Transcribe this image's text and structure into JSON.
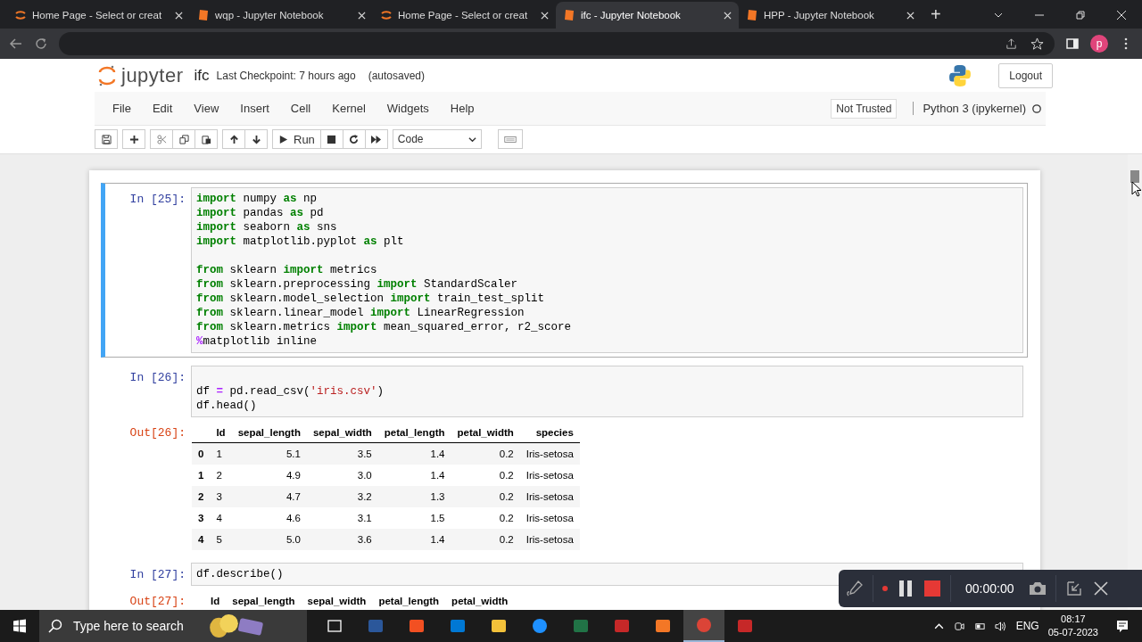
{
  "browser": {
    "tabs": [
      {
        "title": "Home Page - Select or creat",
        "kind": "home",
        "selected": false
      },
      {
        "title": "wqp - Jupyter Notebook",
        "kind": "notebook",
        "selected": false
      },
      {
        "title": "Home Page - Select or creat",
        "kind": "home",
        "selected": false
      },
      {
        "title": "ifc - Jupyter Notebook",
        "kind": "notebook",
        "selected": true
      },
      {
        "title": "HPP - Jupyter Notebook",
        "kind": "notebook",
        "selected": false
      }
    ],
    "new_tab": "+",
    "profile": "p"
  },
  "header": {
    "logo": "jupyter",
    "notebook_name": "ifc",
    "checkpoint": "Last Checkpoint: 7 hours ago",
    "autosave": "(autosaved)",
    "logout": "Logout"
  },
  "menu": [
    "File",
    "Edit",
    "View",
    "Insert",
    "Cell",
    "Kernel",
    "Widgets",
    "Help"
  ],
  "trust": "Not Trusted",
  "kernel": "Python 3 (ipykernel)",
  "toolbar": {
    "run": "Run",
    "cell_type": "Code"
  },
  "cells": [
    {
      "prompt": "In [25]:",
      "selected": true,
      "lines": [
        {
          "tokens": [
            {
              "text": "import",
              "kind": "kw"
            },
            {
              "text": " numpy ",
              "kind": "plain"
            },
            {
              "text": "as",
              "kind": "kw"
            },
            {
              "text": " np",
              "kind": "plain"
            }
          ]
        },
        {
          "tokens": [
            {
              "text": "import",
              "kind": "kw"
            },
            {
              "text": " pandas ",
              "kind": "plain"
            },
            {
              "text": "as",
              "kind": "kw"
            },
            {
              "text": " pd",
              "kind": "plain"
            }
          ]
        },
        {
          "tokens": [
            {
              "text": "import",
              "kind": "kw"
            },
            {
              "text": " seaborn ",
              "kind": "plain"
            },
            {
              "text": "as",
              "kind": "kw"
            },
            {
              "text": " sns",
              "kind": "plain"
            }
          ]
        },
        {
          "tokens": [
            {
              "text": "import",
              "kind": "kw"
            },
            {
              "text": " matplotlib.pyplot ",
              "kind": "plain"
            },
            {
              "text": "as",
              "kind": "kw"
            },
            {
              "text": " plt",
              "kind": "plain"
            }
          ]
        },
        {
          "blank_above": true,
          "tokens": [
            {
              "text": "from",
              "kind": "kw"
            },
            {
              "text": " sklearn ",
              "kind": "plain"
            },
            {
              "text": "import",
              "kind": "kw"
            },
            {
              "text": " metrics",
              "kind": "plain"
            }
          ]
        },
        {
          "tokens": [
            {
              "text": "from",
              "kind": "kw"
            },
            {
              "text": " sklearn.preprocessing ",
              "kind": "plain"
            },
            {
              "text": "import",
              "kind": "kw"
            },
            {
              "text": " StandardScaler",
              "kind": "plain"
            }
          ]
        },
        {
          "tokens": [
            {
              "text": "from",
              "kind": "kw"
            },
            {
              "text": " sklearn.model_selection ",
              "kind": "plain"
            },
            {
              "text": "import",
              "kind": "kw"
            },
            {
              "text": " train_test_split",
              "kind": "plain"
            }
          ]
        },
        {
          "tokens": [
            {
              "text": "from",
              "kind": "kw"
            },
            {
              "text": " sklearn.linear_model ",
              "kind": "plain"
            },
            {
              "text": "import",
              "kind": "kw"
            },
            {
              "text": " LinearRegression",
              "kind": "plain"
            }
          ]
        },
        {
          "tokens": [
            {
              "text": "from",
              "kind": "kw"
            },
            {
              "text": " sklearn.metrics ",
              "kind": "plain"
            },
            {
              "text": "import",
              "kind": "kw"
            },
            {
              "text": " mean_squared_error, r2_score",
              "kind": "plain"
            }
          ]
        },
        {
          "tokens": [
            {
              "text": "%",
              "kind": "op"
            },
            {
              "text": "matplotlib inline",
              "kind": "plain"
            }
          ]
        }
      ]
    },
    {
      "prompt": "In [26]:",
      "selected": false,
      "lines": [
        {
          "blank_above": true,
          "tokens": [
            {
              "text": "df ",
              "kind": "plain"
            },
            {
              "text": "=",
              "kind": "op"
            },
            {
              "text": " pd.read_csv(",
              "kind": "plain"
            },
            {
              "text": "'iris.csv'",
              "kind": "str"
            },
            {
              "text": ")",
              "kind": "plain"
            }
          ]
        },
        {
          "tokens": [
            {
              "text": "df.head()",
              "kind": "plain"
            }
          ]
        }
      ],
      "output": {
        "prompt": "Out[26]:",
        "columns": [
          "",
          "Id",
          "sepal_length",
          "sepal_width",
          "petal_length",
          "petal_width",
          "species"
        ],
        "rows": [
          [
            "0",
            "1",
            "5.1",
            "3.5",
            "1.4",
            "0.2",
            "Iris-setosa"
          ],
          [
            "1",
            "2",
            "4.9",
            "3.0",
            "1.4",
            "0.2",
            "Iris-setosa"
          ],
          [
            "2",
            "3",
            "4.7",
            "3.2",
            "1.3",
            "0.2",
            "Iris-setosa"
          ],
          [
            "3",
            "4",
            "4.6",
            "3.1",
            "1.5",
            "0.2",
            "Iris-setosa"
          ],
          [
            "4",
            "5",
            "5.0",
            "3.6",
            "1.4",
            "0.2",
            "Iris-setosa"
          ]
        ]
      }
    },
    {
      "prompt": "In [27]:",
      "selected": false,
      "lines": [
        {
          "tokens": [
            {
              "text": "df.describe()",
              "kind": "plain"
            }
          ]
        }
      ],
      "output": {
        "prompt": "Out[27]:",
        "columns": [
          "",
          "Id",
          "sepal_length",
          "sepal_width",
          "petal_length",
          "petal_width"
        ]
      }
    }
  ],
  "recorder": {
    "time": "00:00:00"
  },
  "taskbar": {
    "search_placeholder": "Type here to search",
    "apps": [
      {
        "kind": "taskview",
        "selected": false
      },
      {
        "kind": "word",
        "selected": false
      },
      {
        "kind": "store",
        "selected": false
      },
      {
        "kind": "mail",
        "selected": false
      },
      {
        "kind": "folder",
        "selected": false
      },
      {
        "kind": "edge",
        "selected": false
      },
      {
        "kind": "excel",
        "selected": false
      },
      {
        "kind": "recorder",
        "selected": false
      },
      {
        "kind": "jupyter",
        "selected": false
      },
      {
        "kind": "chrome",
        "selected": true
      },
      {
        "kind": "recorder",
        "selected": false
      }
    ],
    "language": "ENG",
    "time": "08:17",
    "date": "05-07-2023"
  }
}
